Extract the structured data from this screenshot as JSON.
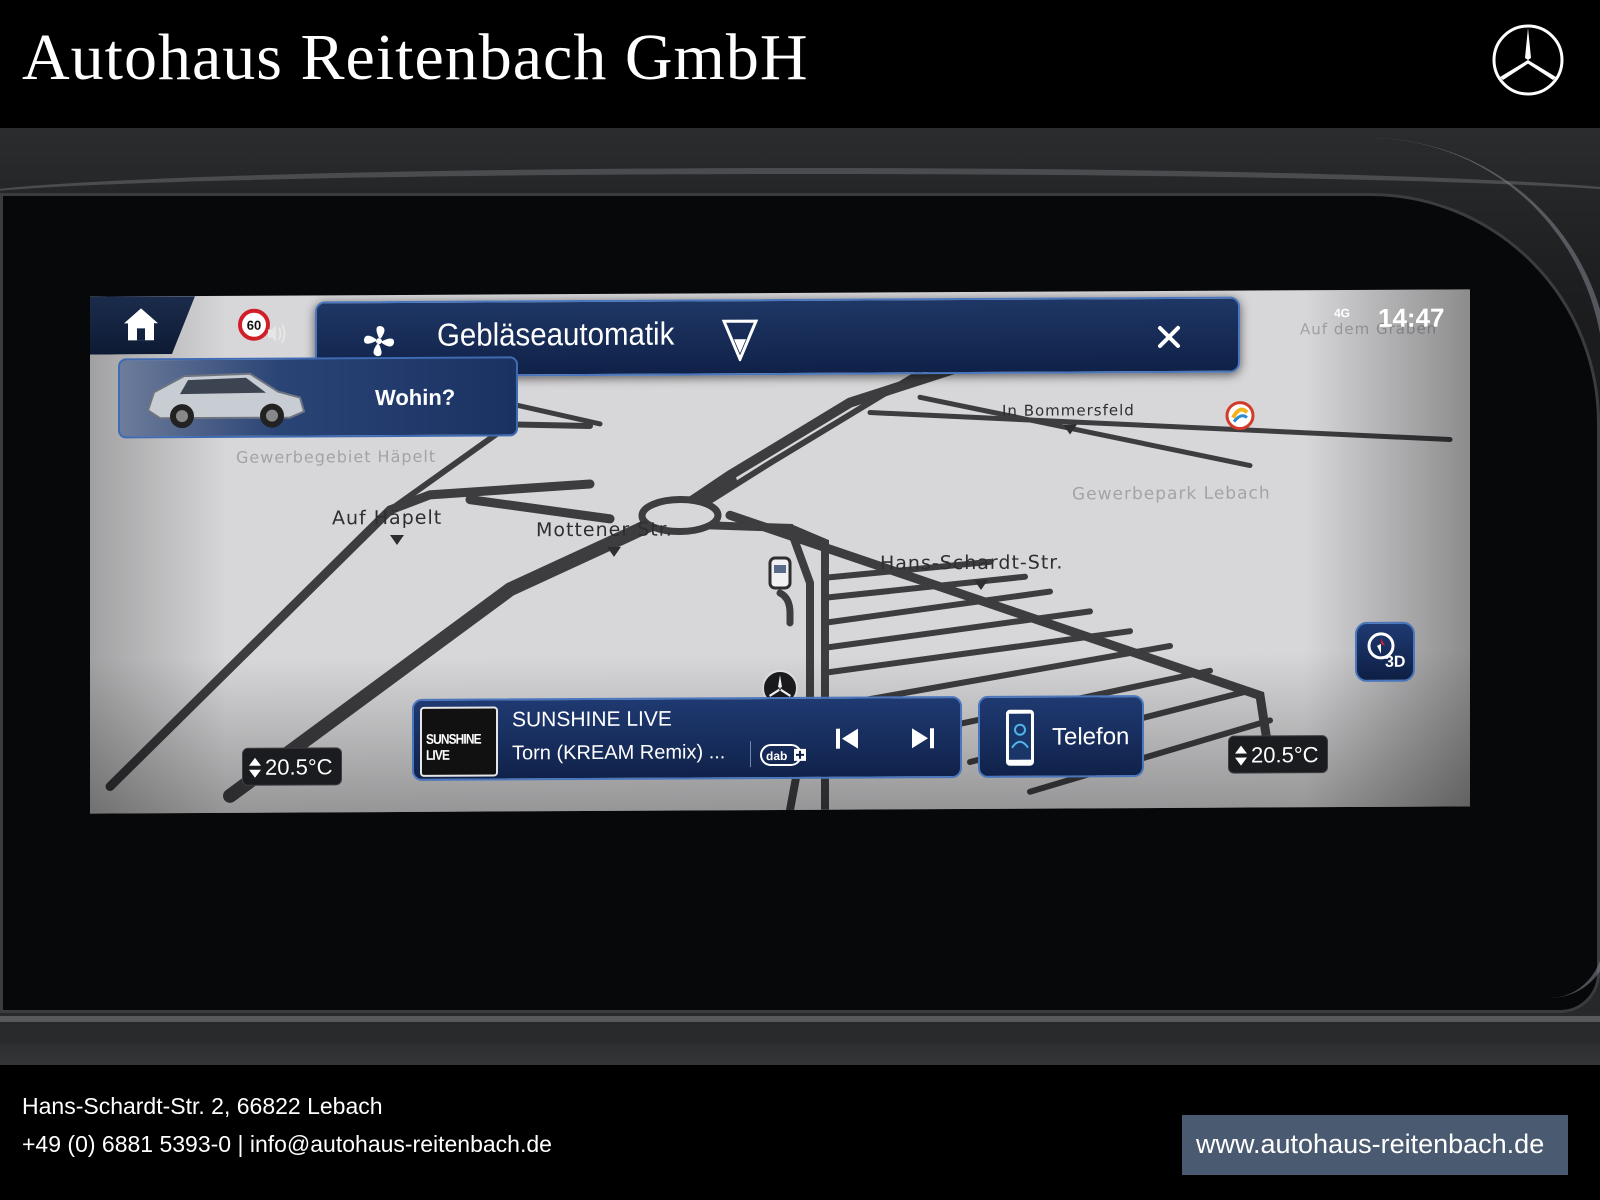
{
  "dealer": {
    "name": "Autohaus Reitenbach GmbH",
    "address": "Hans-Schardt-Str. 2, 66822 Lebach",
    "contact": "+49 (0) 6881 5393-0  |  info@autohaus-reitenbach.de",
    "website": "www.autohaus-reitenbach.de",
    "logo_icon": "mercedes-star-icon"
  },
  "screen": {
    "status": {
      "network": "4G",
      "time": "14:47"
    },
    "climate_bar": {
      "title": "Gebläseautomatik",
      "fan_icon": "fan-icon",
      "level_icon": "fan-level-icon",
      "close_icon": "close-icon"
    },
    "speed_limit": {
      "value": "60",
      "icon": "speed-limit-sound-icon"
    },
    "destination": {
      "label": "Wohin?"
    },
    "map": {
      "labels": {
        "gewerbegebiet": "Gewerbegebiet Häpelt",
        "auf_haepelt": "Auf Häpelt",
        "mottener": "Mottener Str.",
        "hans_schardt": "Hans-Schardt-Str.",
        "in_bommersfeld": "In Bommersfeld",
        "gewerbepark": "Gewerbepark Lebach",
        "auf_dem_graben": "Auf dem Graben"
      },
      "view_button": "3D"
    },
    "temperature": {
      "left": "20.5°C",
      "right": "20.5°C"
    },
    "media": {
      "station_logo": "SUNSHINE LIVE",
      "station": "SUNSHINE LIVE",
      "track": "Torn (KREAM Remix) ...",
      "source_icon": "dab-plus-icon"
    },
    "phone": {
      "label": "Telefon"
    }
  }
}
